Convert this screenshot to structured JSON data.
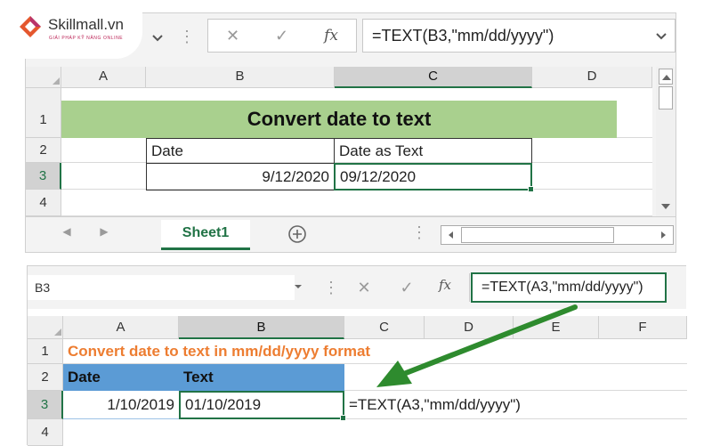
{
  "logo": {
    "brand": "Skillmall.vn",
    "tagline": "GIẢI PHÁP KỸ NĂNG ONLINE",
    "icon": "skillmall-logo-mark"
  },
  "window1": {
    "formula": "=TEXT(B3,\"mm/dd/yyyy\")",
    "columns": [
      "A",
      "B",
      "C",
      "D"
    ],
    "rows": [
      "1",
      "2",
      "3",
      "4"
    ],
    "title": "Convert date to text",
    "header_date": "Date",
    "header_text": "Date as Text",
    "date_value": "9/12/2020",
    "text_value": "09/12/2020",
    "sheet_tab": "Sheet1",
    "title_fill": "#a9d08e",
    "cancel_icon": "✕",
    "enter_icon": "✓",
    "fx_icon": "fx"
  },
  "window2": {
    "name_box": "B3",
    "formula": "=TEXT(A3,\"mm/dd/yyyy\")",
    "columns": [
      "A",
      "B",
      "C",
      "D",
      "E",
      "F"
    ],
    "rows": [
      "1",
      "2",
      "3",
      "4"
    ],
    "title": "Convert date to text in mm/dd/yyyy format",
    "header_date": "Date",
    "header_text": "Text",
    "date_value": "1/10/2019",
    "text_value": "01/10/2019",
    "formula_note": "=TEXT(A3,\"mm/dd/yyyy\")",
    "title_color": "#ed7d31",
    "header_fill": "#5b9bd5",
    "accent": "#217346"
  }
}
